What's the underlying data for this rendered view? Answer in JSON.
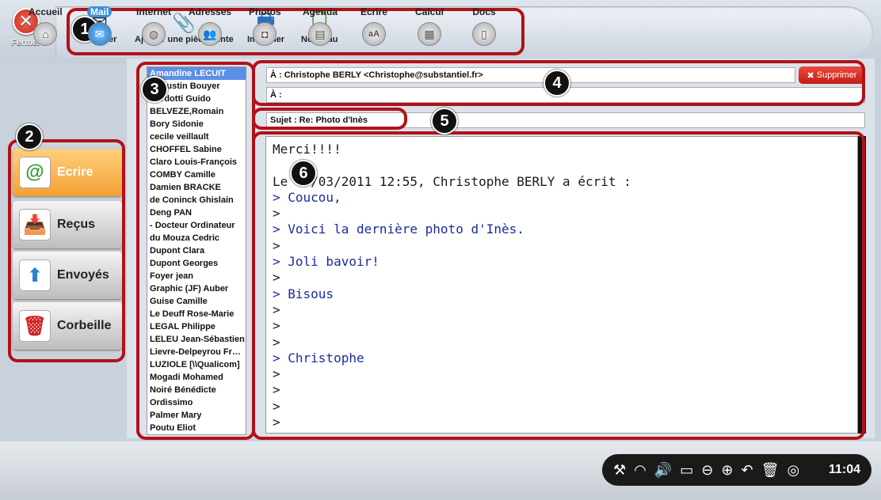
{
  "toolbar": {
    "close_label": "Fermer",
    "send_label": "Envoyer",
    "attach_label": "Ajouter une pièce jointe",
    "print_label": "Imprimer",
    "new_label": "Nouveau"
  },
  "leftnav": {
    "write_label": "Ecrire",
    "received_label": "Reçus",
    "sent_label": "Envoyés",
    "trash_label": "Corbeille"
  },
  "contacts": [
    "Amandine LECUIT",
    "Augustin Bouyer",
    "Bardotti Guido",
    "BELVEZE,Romain",
    "Bory Sidonie",
    "cecile veillault",
    "CHOFFEL Sabine",
    "Claro Louis-François",
    "COMBY Camille",
    "Damien  BRACKE",
    "de Coninck Ghislain",
    "Deng PAN",
    "- Docteur Ordinateur",
    "du Mouza Cedric",
    "Dupont Clara",
    "Dupont Georges",
    "Foyer jean",
    "Graphic (JF) Auber",
    "Guise Camille",
    "Le Deuff Rose-Marie",
    "LEGAL Philippe",
    "LELEU Jean-Sébastien",
    "Lievre-Delpeyrou Françoise",
    "LUZIOLE [\\\\Qualicom]",
    "Mogadi Mohamed",
    "Noiré Bénédicte",
    "Ordissimo",
    "Palmer Mary",
    "Poutu Eliot"
  ],
  "compose": {
    "to_primary": "À : Christophe BERLY <Christophe@substantiel.fr>",
    "to_secondary": "À :",
    "delete_label": "Supprimer",
    "subject": "Sujet : Re: Photo d'Inès"
  },
  "message_lines": [
    {
      "text": "Merci!!!!",
      "quote": false
    },
    {
      "text": "",
      "quote": false
    },
    {
      "text": "Le 03/03/2011 12:55, Christophe BERLY a écrit :",
      "quote": false
    },
    {
      "text": "> Coucou,",
      "quote": true
    },
    {
      "text": ">",
      "quote": false
    },
    {
      "text": "> Voici la dernière photo d'Inès.",
      "quote": true
    },
    {
      "text": ">",
      "quote": false
    },
    {
      "text": "> Joli bavoir!",
      "quote": true
    },
    {
      "text": ">",
      "quote": false
    },
    {
      "text": "> Bisous",
      "quote": true
    },
    {
      "text": ">",
      "quote": false
    },
    {
      "text": ">",
      "quote": false
    },
    {
      "text": ">",
      "quote": false
    },
    {
      "text": "> Christophe",
      "quote": true
    },
    {
      "text": ">",
      "quote": false
    },
    {
      "text": ">",
      "quote": false
    },
    {
      "text": ">",
      "quote": false
    },
    {
      "text": ">",
      "quote": false
    }
  ],
  "badges": [
    "1",
    "2",
    "3",
    "4",
    "5",
    "6"
  ],
  "dock": {
    "home": "Accueil",
    "mail": "Mail",
    "internet": "Internet",
    "addresses": "Adresses",
    "photos": "Photos",
    "agenda": "Agenda",
    "write": "Ecrire",
    "calc": "Calcul",
    "docs": "Docs"
  },
  "tray": {
    "time": "11:04"
  },
  "colors": {
    "annotation": "#b0121a",
    "selected_contact": "#5b8ee6",
    "write_button": "#f4a035",
    "quote_text": "#1b2b9c"
  }
}
